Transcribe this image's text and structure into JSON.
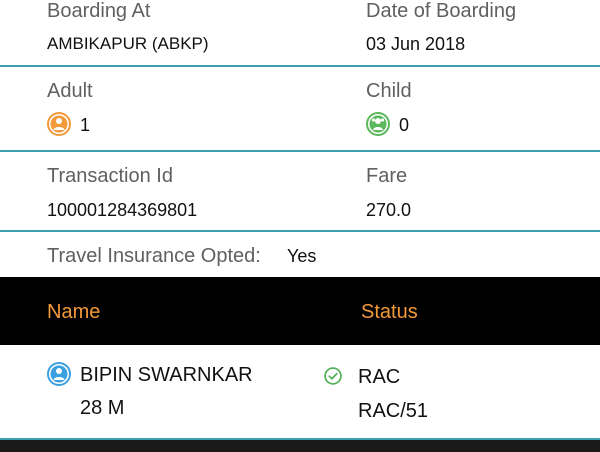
{
  "journey": {
    "boarding_at_label": "Boarding At",
    "boarding_at_value": "AMBIKAPUR (ABKP)",
    "date_label": "Date of Boarding",
    "date_value": "03 Jun 2018"
  },
  "passengers_count": {
    "adult_label": "Adult",
    "adult_value": "1",
    "child_label": "Child",
    "child_value": "0"
  },
  "transaction": {
    "id_label": "Transaction Id",
    "id_value": "100001284369801",
    "fare_label": "Fare",
    "fare_value": "270.0"
  },
  "insurance": {
    "label": "Travel Insurance Opted:",
    "value": "Yes"
  },
  "table": {
    "header_name": "Name",
    "header_status": "Status",
    "rows": [
      {
        "name": "BIPIN SWARNKAR",
        "age_gender": "28 M",
        "status": "RAC",
        "status_detail": "RAC/51"
      }
    ]
  },
  "icons": {
    "adult": "adult-person-icon",
    "child": "child-person-icon",
    "passenger": "passenger-avatar-icon",
    "status": "check-circle-icon"
  },
  "colors": {
    "separator": "#3f9fae",
    "header_bg": "#000000",
    "header_text": "#f39a3a",
    "adult_icon": "#f39a3a",
    "child_icon": "#5cb85c",
    "passenger_icon": "#3aa0e0",
    "status_check": "#4caf50"
  }
}
